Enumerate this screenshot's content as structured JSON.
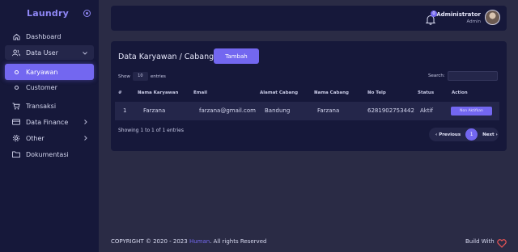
{
  "sidebar": {
    "brand": "Laundry",
    "items": [
      {
        "label": "Dashboard",
        "icon": "home-icon"
      },
      {
        "label": "Data User",
        "icon": "users-icon"
      },
      {
        "label": "Karyawan",
        "icon": "circle-icon"
      },
      {
        "label": "Customer",
        "icon": "circle-icon"
      },
      {
        "label": "Transaksi",
        "icon": "cart-icon"
      },
      {
        "label": "Data Finance",
        "icon": "card-icon"
      },
      {
        "label": "Other",
        "icon": "gear-icon"
      },
      {
        "label": "Dokumentasi",
        "icon": "folder-icon"
      }
    ]
  },
  "header": {
    "notification_count": "0",
    "user_name": "Administrator",
    "user_role": "Admin"
  },
  "card": {
    "title": "Data Karyawan / Cabang",
    "add_button": "Tambah",
    "show_label": "Show",
    "entries_value": "10",
    "entries_label": "entries",
    "search_label": "Search:",
    "search_value": ""
  },
  "table": {
    "headers": [
      "#",
      "Nama Karyawan",
      "Email",
      "Alamat Cabang",
      "Nama Cabang",
      "No Telp",
      "Status",
      "Action"
    ],
    "rows": [
      {
        "no": "1",
        "nama": "Farzana",
        "email": "farzana@gmail.com",
        "alamat": "Bandung",
        "cabang": "Farzana",
        "telp": "6281902753442",
        "status": "Aktif",
        "action": "Non Aktifkan"
      }
    ]
  },
  "pagination": {
    "info": "Showing 1 to 1 of 1 entries",
    "previous": "Previous",
    "current": "1",
    "next": "Next"
  },
  "footer": {
    "copyright_prefix": "COPYRIGHT © 2020 - 2023",
    "brand": "Human",
    "copyright_suffix": ". All rights Reserved",
    "build_with": "Build With"
  },
  "colors": {
    "accent": "#7367f0",
    "sidebar_bg": "#16183a",
    "page_bg": "#2a2b45",
    "heart": "#ea5455"
  }
}
